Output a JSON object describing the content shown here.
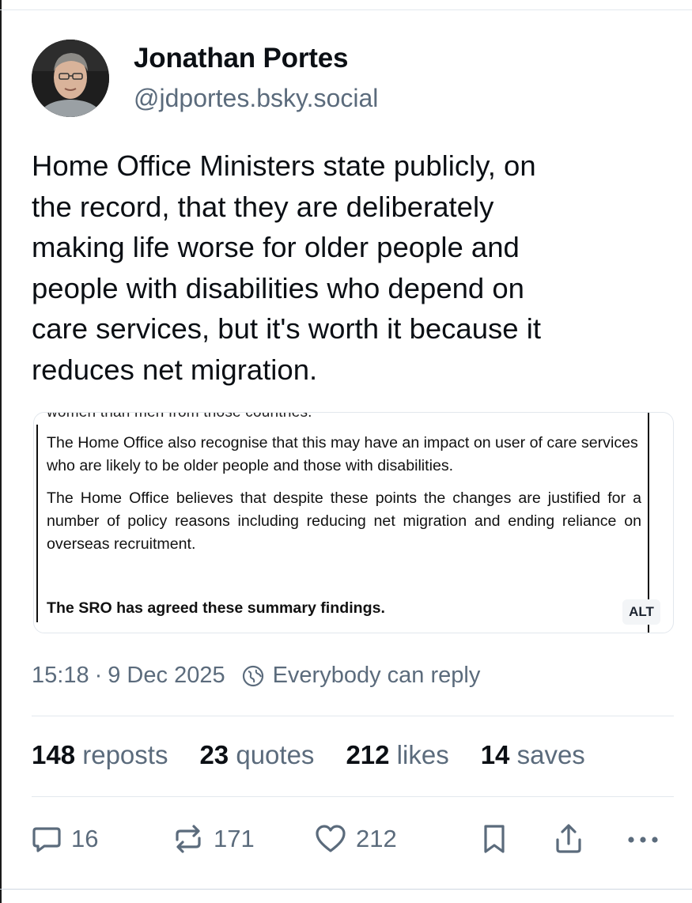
{
  "author": {
    "name": "Jonathan Portes",
    "handle": "@jdportes.bsky.social",
    "avatar_icon": "profile-photo"
  },
  "post": {
    "text": "Home Office Ministers state publicly, on\nthe record, that they are deliberately\nmaking life worse for older people and\npeople with disabilities  who depend on\ncare services, but it's worth it because it\nreduces net migration."
  },
  "embed": {
    "cut_text": "women than men from those countries.",
    "paragraph1": "The Home Office also recognise that this may have an impact on user of care services who are likely to be older people and those with disabilities.",
    "paragraph2": "The Home Office believes that despite these points the changes are justified for a number of policy reasons including reducing net migration and ending reliance on overseas recruitment.",
    "paragraph3": "The SRO has agreed these summary findings.",
    "alt_label": "ALT"
  },
  "meta": {
    "time": "15:18",
    "separator": "·",
    "date": "9 Dec 2025",
    "reply_setting": "Everybody can reply"
  },
  "stats": {
    "reposts_count": "148",
    "reposts_label": "reposts",
    "quotes_count": "23",
    "quotes_label": "quotes",
    "likes_count": "212",
    "likes_label": "likes",
    "saves_count": "14",
    "saves_label": "saves"
  },
  "actions": {
    "reply_count": "16",
    "repost_count": "171",
    "like_count": "212"
  },
  "colors": {
    "text": "#0b0f14",
    "muted": "#5b6b7c",
    "divider": "#e3e8ee"
  }
}
